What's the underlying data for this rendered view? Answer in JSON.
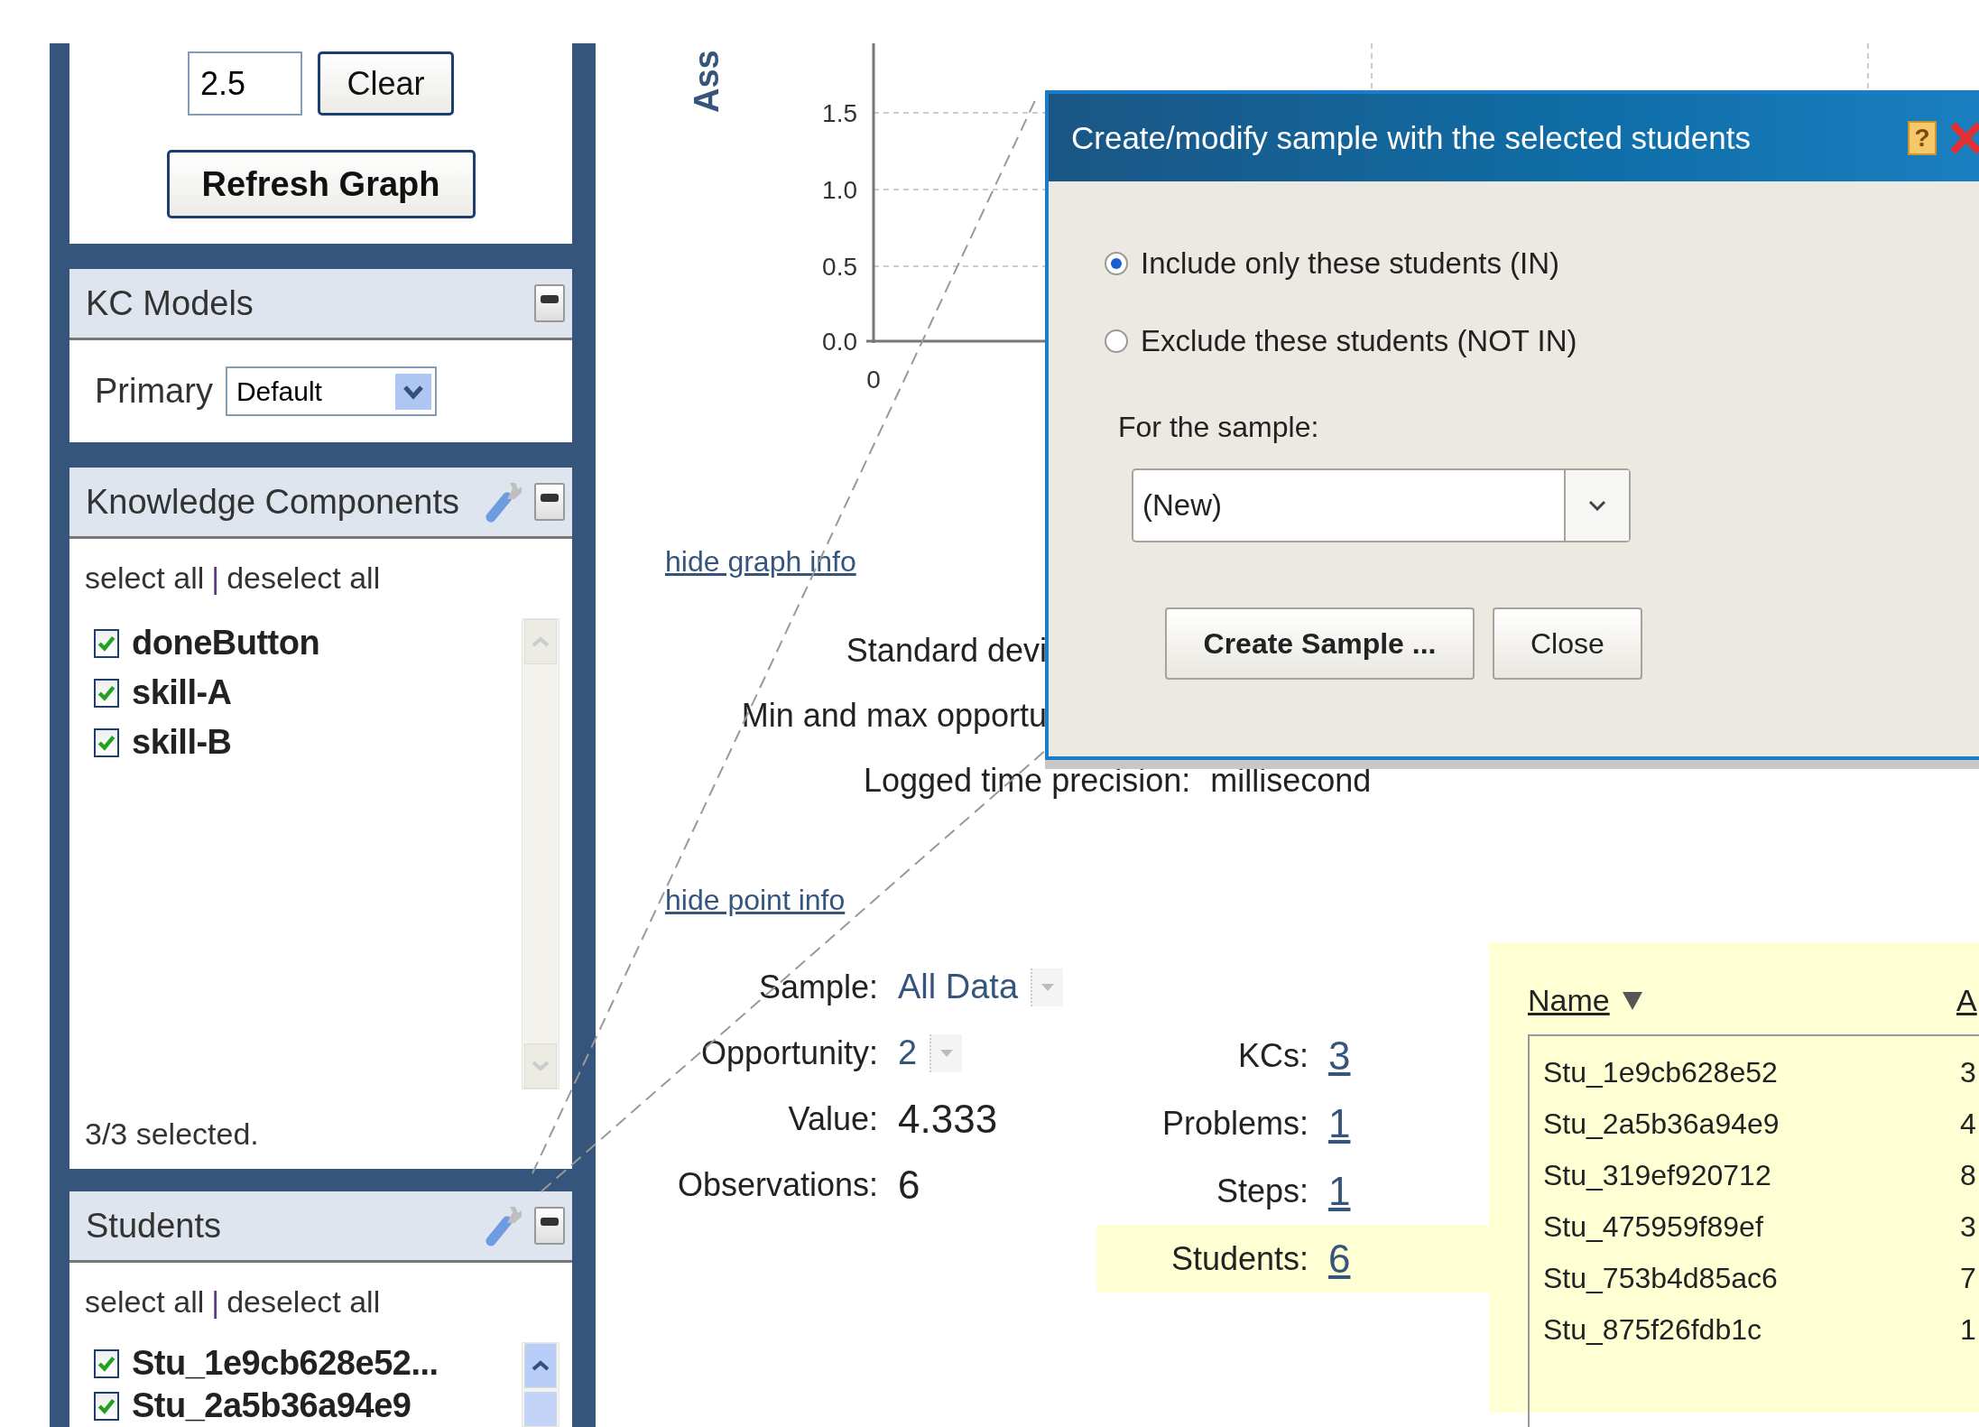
{
  "sidebar": {
    "threshold_input": {
      "value": "2.5"
    },
    "clear_button": "Clear",
    "refresh_button": "Refresh Graph",
    "kc_models": {
      "title": "KC Models",
      "primary_label": "Primary",
      "primary_value": "Default"
    },
    "knowledge_components": {
      "title": "Knowledge Components",
      "select_all": "select all",
      "separator": "|",
      "deselect_all": "deselect all",
      "items": [
        {
          "label": "doneButton",
          "checked": true
        },
        {
          "label": "skill-A",
          "checked": true
        },
        {
          "label": "skill-B",
          "checked": true
        }
      ],
      "status": "3/3 selected."
    },
    "students": {
      "title": "Students",
      "select_all": "select all",
      "separator": "|",
      "deselect_all": "deselect all",
      "items": [
        {
          "label": "Stu_1e9cb628e52...",
          "checked": true
        },
        {
          "label": "Stu_2a5b36a94e9",
          "checked": true
        }
      ]
    }
  },
  "chart": {
    "ylabel": "Ass",
    "yticks": [
      "1.5",
      "1.0",
      "0.5",
      "0.0"
    ],
    "xticks": [
      "0"
    ]
  },
  "graph_info": {
    "toggle_link": "hide graph info",
    "rows": [
      {
        "label": "Standard devi"
      },
      {
        "label": "Min and max opportu"
      },
      {
        "label": "Logged time precision:",
        "value": "millisecond"
      }
    ]
  },
  "point_info": {
    "toggle_link": "hide point info",
    "fields": [
      {
        "label": "Sample:",
        "value": "All Data",
        "kind": "dropdown"
      },
      {
        "label": "Opportunity:",
        "value": "2",
        "kind": "dropdown"
      },
      {
        "label": "Value:",
        "value": "4.333",
        "kind": "plain"
      },
      {
        "label": "Observations:",
        "value": "6",
        "kind": "plain"
      }
    ],
    "counts": [
      {
        "label": "KCs:",
        "value": "3",
        "selected": false
      },
      {
        "label": "Problems:",
        "value": "1",
        "selected": false
      },
      {
        "label": "Steps:",
        "value": "1",
        "selected": false
      },
      {
        "label": "Students:",
        "value": "6",
        "selected": true
      }
    ],
    "students_table": {
      "columns": [
        "Name",
        "A"
      ],
      "rows": [
        [
          "Stu_1e9cb628e52",
          "3"
        ],
        [
          "Stu_2a5b36a94e9",
          "4"
        ],
        [
          "Stu_319ef920712",
          "8"
        ],
        [
          "Stu_475959f89ef",
          "3"
        ],
        [
          "Stu_753b4d85ac6",
          "7"
        ],
        [
          "Stu_875f26fdb1c",
          "1"
        ]
      ]
    }
  },
  "dialog": {
    "title": "Create/modify sample with the selected students",
    "help_glyph": "?",
    "options": [
      {
        "label": "Include only these students (IN)",
        "selected": true
      },
      {
        "label": "Exclude these students (NOT IN)",
        "selected": false
      }
    ],
    "sample_label": "For the sample:",
    "sample_value": "(New)",
    "buttons": [
      "Create Sample ...",
      "Close"
    ]
  }
}
